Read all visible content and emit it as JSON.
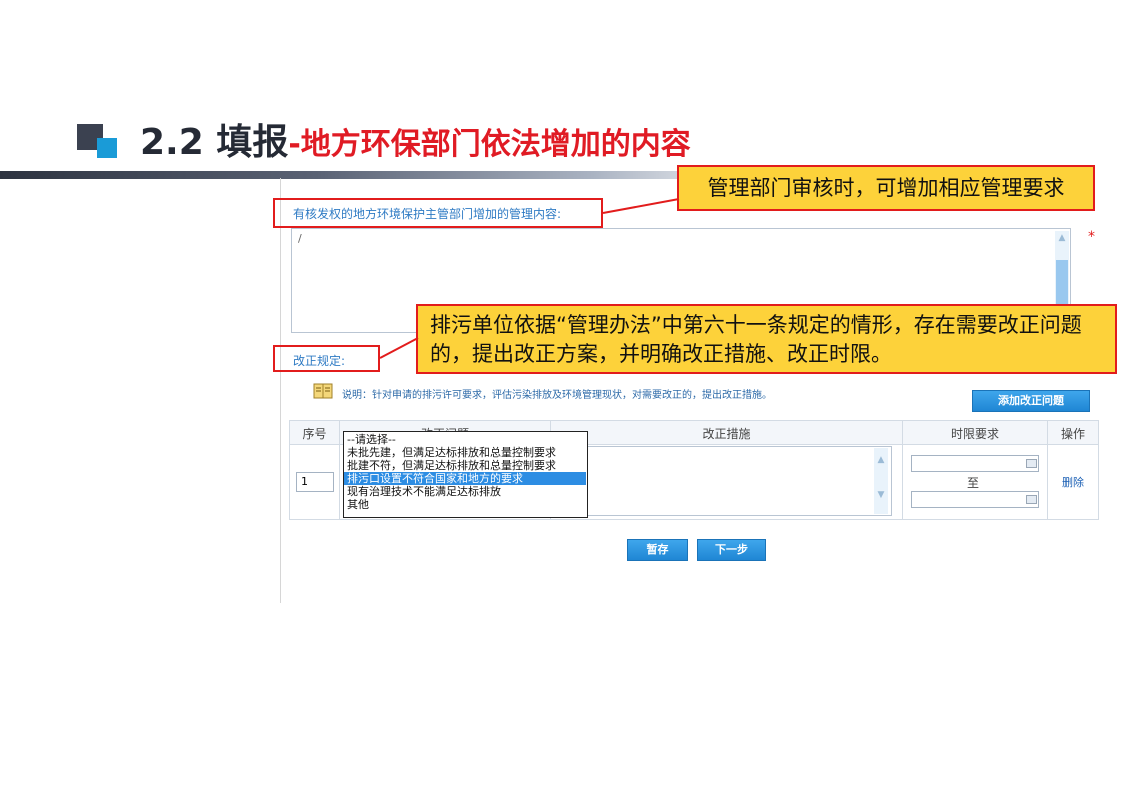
{
  "slide": {
    "title_number": "2.2",
    "title_main": "填报",
    "title_sub": "-地方环保部门依法增加的内容"
  },
  "form": {
    "mgmt_label": "有核发权的地方环境保护主管部门增加的管理内容:",
    "mgmt_value": "/",
    "required_mark": "*",
    "rect_label": "改正规定:",
    "note_text": "说明：针对申请的排污许可要求，评估污染排放及环境管理现状，对需要改正的，提出改正措施。",
    "add_button": "添加改正问题",
    "table": {
      "headers": [
        "序号",
        "改正问题",
        "改正措施",
        "时限要求",
        "操作"
      ],
      "row": {
        "seq": "1",
        "to_text": "至",
        "delete_label": "删除"
      }
    },
    "dropdown": {
      "options": [
        "--请选择--",
        "未批先建，但满足达标排放和总量控制要求",
        "批建不符，但满足达标排放和总量控制要求",
        "排污口设置不符合国家和地方的要求",
        "现有治理技术不能满足达标排放",
        "其他"
      ],
      "selected_index": 3
    },
    "save_button": "暂存",
    "next_button": "下一步"
  },
  "callouts": {
    "callout1": "管理部门审核时，可增加相应管理要求",
    "callout2": "排污单位依据“管理办法”中第六十一条规定的情形，存在需要改正问题的，提出改正方案，并明确改正措施、改正时限。"
  },
  "colors": {
    "accent_red": "#e21c1c",
    "callout_yellow": "#fdd23a",
    "button_blue": "#1f86d4",
    "label_blue": "#2f7bc4"
  }
}
